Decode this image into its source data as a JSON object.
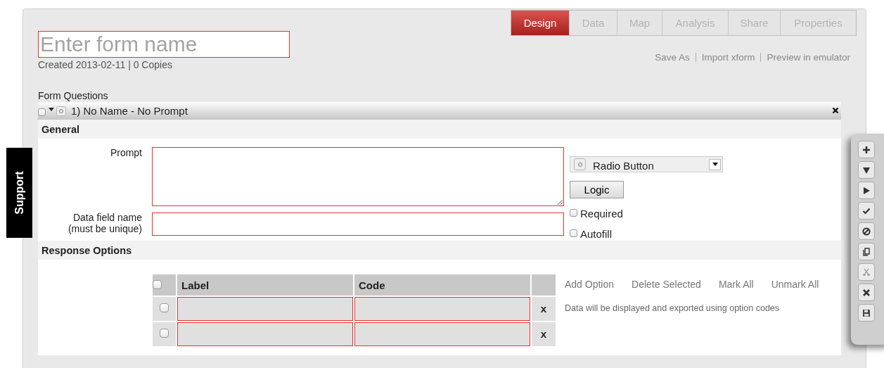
{
  "support_tab": {
    "label": "Support"
  },
  "tabs": [
    {
      "label": "Design",
      "selected": true
    },
    {
      "label": "Data",
      "selected": false
    },
    {
      "label": "Map",
      "selected": false
    },
    {
      "label": "Analysis",
      "selected": false
    },
    {
      "label": "Share",
      "selected": false
    },
    {
      "label": "Properties",
      "selected": false
    }
  ],
  "form_name": {
    "placeholder": "Enter form name"
  },
  "form_meta": "Created 2013-02-11 | 0 Copies",
  "header_links": [
    "Save As",
    "Import xform",
    "Preview in emulator"
  ],
  "section_title": "Form Questions",
  "question": {
    "checked": false,
    "title": "1) No Name - No Prompt",
    "general": {
      "title": "General",
      "prompt_label": "Prompt",
      "field_label": "Data field name",
      "field_hint": "(must be unique)",
      "type": "Radio Button",
      "logic_button": "Logic",
      "options": [
        {
          "label": "Required",
          "checked": false
        },
        {
          "label": "Autofill",
          "checked": false
        }
      ]
    },
    "response": {
      "title": "Response Options",
      "columns": [
        "Label",
        "Code"
      ],
      "header_checked": false,
      "rows": [
        {
          "checked": false,
          "delete": "x"
        },
        {
          "checked": false,
          "delete": "x"
        }
      ],
      "actions": [
        "Add Option",
        "Delete Selected",
        "Mark All",
        "Unmark All"
      ],
      "note": "Data will be displayed and exported using option codes"
    }
  },
  "toolbar": [
    {
      "kind": "add",
      "disabled": false
    },
    {
      "kind": "down",
      "disabled": false
    },
    {
      "kind": "right",
      "disabled": false
    },
    {
      "kind": "check",
      "disabled": false
    },
    {
      "kind": "ban",
      "disabled": false
    },
    {
      "kind": "copy",
      "disabled": false
    },
    {
      "kind": "cut",
      "disabled": true
    },
    {
      "kind": "delete",
      "disabled": false
    },
    {
      "kind": "save",
      "disabled": false
    }
  ]
}
